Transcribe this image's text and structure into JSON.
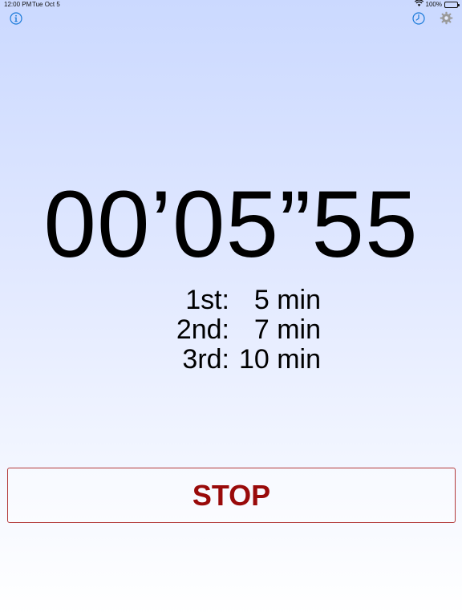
{
  "status_bar": {
    "time": "12:00 PM",
    "date": "Tue Oct 5",
    "battery": "100%",
    "icons": [
      "wifi-icon",
      "battery-icon"
    ]
  },
  "toolbar": {
    "left_icon": "info-icon",
    "right_icons": [
      "history-clock-icon",
      "gear-icon"
    ],
    "accent_color": "#1a7ad9"
  },
  "timer": {
    "display": "00’05”55"
  },
  "reminders": [
    {
      "ordinal": "1st:",
      "value": "5 min"
    },
    {
      "ordinal": "2nd:",
      "value": "7 min"
    },
    {
      "ordinal": "3rd:",
      "value": "10 min"
    }
  ],
  "stop_button": {
    "label": "STOP",
    "color": "#990a0a"
  }
}
